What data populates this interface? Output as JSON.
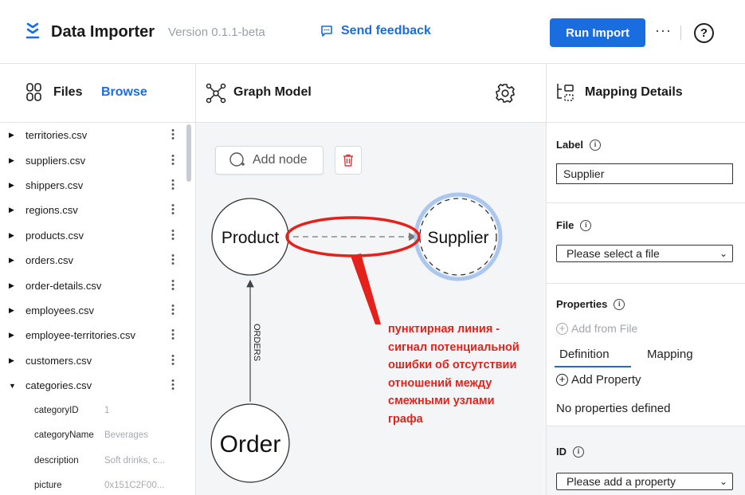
{
  "header": {
    "app_title": "Data Importer",
    "version": "Version 0.1.1-beta",
    "feedback_label": "Send feedback",
    "run_import_label": "Run Import",
    "more_label": "···",
    "help_label": "?"
  },
  "files_panel": {
    "title": "Files",
    "browse_label": "Browse",
    "files": [
      {
        "name": "territories.csv"
      },
      {
        "name": "suppliers.csv"
      },
      {
        "name": "shippers.csv"
      },
      {
        "name": "regions.csv"
      },
      {
        "name": "products.csv"
      },
      {
        "name": "orders.csv"
      },
      {
        "name": "order-details.csv"
      },
      {
        "name": "employees.csv"
      },
      {
        "name": "employee-territories.csv"
      },
      {
        "name": "customers.csv"
      },
      {
        "name": "categories.csv"
      }
    ],
    "expanded_fields": [
      {
        "name": "categoryID",
        "value": "1"
      },
      {
        "name": "categoryName",
        "value": "Beverages"
      },
      {
        "name": "description",
        "value": "Soft drinks, c..."
      },
      {
        "name": "picture",
        "value": "0x151C2F00..."
      }
    ]
  },
  "graph_panel": {
    "title": "Graph Model",
    "add_node_label": "Add node",
    "nodes": {
      "product": "Product",
      "supplier": "Supplier",
      "order": "Order"
    },
    "relationship_label": "ORDERS"
  },
  "mapping_panel": {
    "title": "Mapping Details",
    "label_title": "Label",
    "label_value": "Supplier",
    "file_title": "File",
    "file_select": "Please select a file",
    "properties_title": "Properties",
    "add_from_file": "Add from File",
    "tab_definition": "Definition",
    "tab_mapping": "Mapping",
    "add_property": "Add Property",
    "no_properties": "No properties defined",
    "id_title": "ID",
    "id_select": "Please add a property"
  },
  "annotation": {
    "lines": [
      "пунктирная линия -",
      "сигнал потенциальной",
      "ошибки об отсутствии",
      "отношений между",
      "смежными узлами",
      "графа"
    ]
  },
  "colors": {
    "accent": "#1a6dde",
    "annotation_red": "#e4221b",
    "selected_node_ring": "#a9c7ef"
  }
}
